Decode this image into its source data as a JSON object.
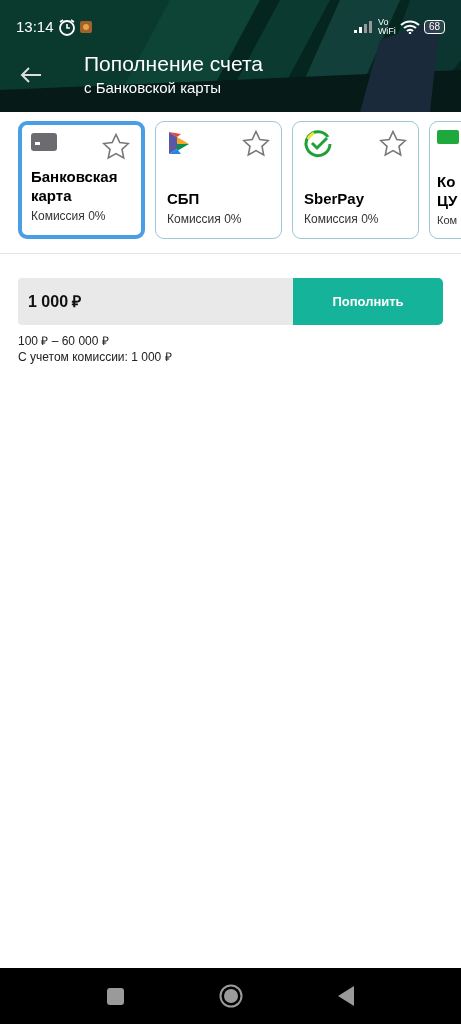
{
  "status_bar": {
    "time": "13:14",
    "network_label_1": "Vo",
    "network_label_2": "WiFi",
    "battery": "68"
  },
  "header": {
    "title": "Пополнение счета",
    "subtitle": "с Банковской карты"
  },
  "methods": [
    {
      "kind": "card",
      "title": "Банковская карта",
      "commission": "Комиссия 0%",
      "selected": true,
      "favorite": false
    },
    {
      "kind": "sbp",
      "title": "СБП",
      "commission": "Комиссия 0%",
      "selected": false,
      "favorite": false
    },
    {
      "kind": "sber",
      "title": "SberPay",
      "commission": "Комиссия 0%",
      "selected": false,
      "favorite": false
    },
    {
      "kind": "cash",
      "title": "Ко ЦУ",
      "commission": "Ком",
      "selected": false
    }
  ],
  "amount": {
    "value": "1 000 ₽",
    "button": "Пополнить",
    "range": "100 ₽ – 60 000 ₽",
    "with_commission": "С учетом комиссии: 1 000 ₽"
  }
}
